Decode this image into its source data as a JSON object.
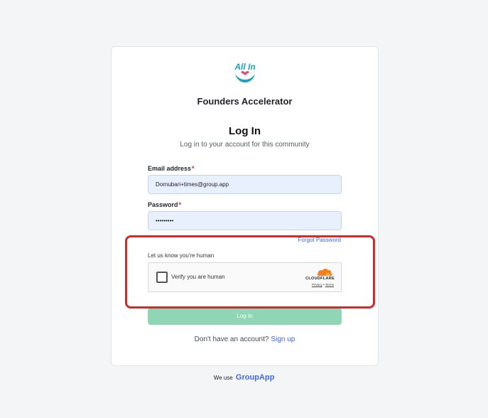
{
  "community": {
    "logo_text": "All In",
    "name": "Founders Accelerator"
  },
  "login": {
    "title": "Log In",
    "subtitle": "Log in to your account for this community",
    "email_label": "Email address",
    "email_value": "Dornubari+times@group.app",
    "password_label": "Password",
    "password_value": "•••••••••",
    "required_marker": "*",
    "forgot_password": "Forgot Password",
    "human_label": "Let us know you're human",
    "submit_label": "Log In"
  },
  "captcha": {
    "label": "Verify you are human",
    "provider": "CLOUDFLARE",
    "privacy": "Privacy",
    "separator": "•",
    "terms": "Terms"
  },
  "signup": {
    "prompt": "Don't have an account?",
    "link": "Sign up"
  },
  "footer": {
    "prefix": "We use",
    "brand": "GroupApp"
  },
  "colors": {
    "accent": "#3d66d6",
    "button": "#8fd6b7",
    "highlight": "#d12c2c",
    "input_bg": "#e8f0fe",
    "logo_teal": "#1aa3b8",
    "logo_heart": "#e8487a",
    "cloudflare_orange": "#f38020"
  }
}
